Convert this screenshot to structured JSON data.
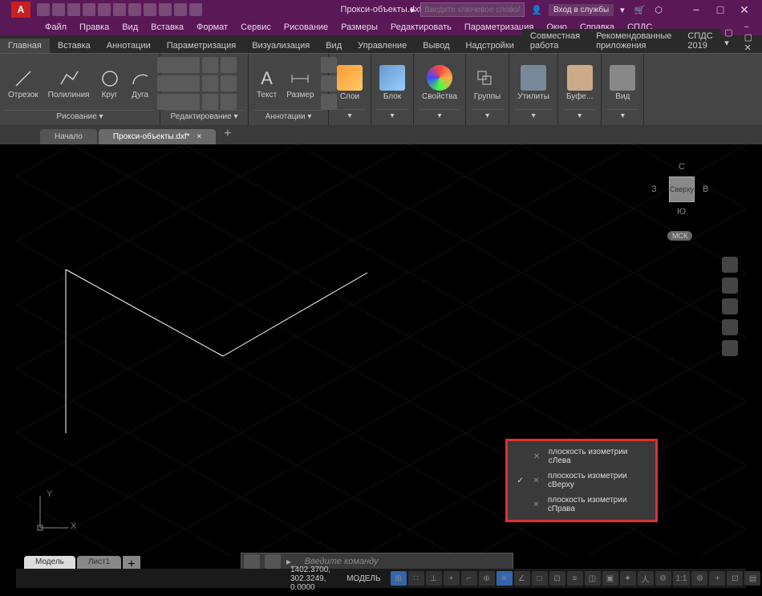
{
  "title": "Прокси-объекты.dxf",
  "search_placeholder": "Введите ключевое слово/фразу",
  "login_label": "Вход в службы",
  "menus": [
    "Файл",
    "Правка",
    "Вид",
    "Вставка",
    "Формат",
    "Сервис",
    "Рисование",
    "Размеры",
    "Редактировать",
    "Параметризация",
    "Окно",
    "Справка",
    "СПДС"
  ],
  "ribbon_tabs": [
    "Главная",
    "Вставка",
    "Аннотации",
    "Параметризация",
    "Визуализация",
    "Вид",
    "Управление",
    "Вывод",
    "Надстройки",
    "Совместная работа",
    "Рекомендованные приложения",
    "СПДС 2019"
  ],
  "panels": {
    "draw": {
      "title": "Рисование ▾",
      "items": [
        "Отрезок",
        "Полилиния",
        "Круг",
        "Дуга"
      ]
    },
    "modify": {
      "title": "Редактирование ▾"
    },
    "annot": {
      "title": "Аннотации ▾",
      "items": [
        "Текст",
        "Размер"
      ]
    },
    "layers": {
      "title": "▾",
      "label": "Слои"
    },
    "block": {
      "title": "▾",
      "label": "Блок"
    },
    "props": {
      "title": "▾",
      "label": "Свойства"
    },
    "groups": {
      "title": "▾",
      "label": "Группы"
    },
    "utils": {
      "title": "▾",
      "label": "Утилиты"
    },
    "buffer": {
      "title": "▾",
      "label": "Буфе..."
    },
    "view": {
      "title": "▾",
      "label": "Вид"
    }
  },
  "file_tabs": {
    "start": "Начало",
    "active": "Прокси-объекты.dxf*"
  },
  "viewcube": {
    "top": "Сверху",
    "n": "С",
    "s": "Ю",
    "e": "В",
    "w": "З",
    "wcs": "МСК"
  },
  "ucs": {
    "x": "X",
    "y": "Y"
  },
  "context_menu": [
    {
      "label": "плоскость изометрии сЛева",
      "checked": false
    },
    {
      "label": "плоскость изометрии сВерху",
      "checked": true
    },
    {
      "label": "плоскость изометрии сПрава",
      "checked": false
    }
  ],
  "cmd_placeholder": "Введите команду",
  "bottom_tabs": {
    "model": "Модель",
    "sheet": "Лист1"
  },
  "status": {
    "coords": "1402.3700, 302.3249, 0.0000",
    "model": "МОДЕЛЬ",
    "scale": "1:1"
  }
}
